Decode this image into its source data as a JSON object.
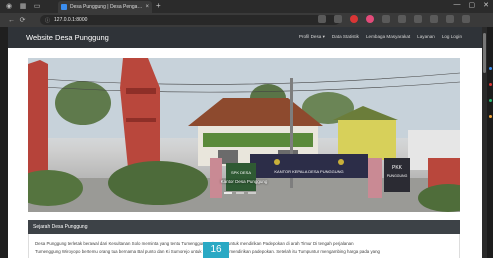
{
  "browser": {
    "tab_title": "Desa Punggung | Desa Pengadu...",
    "tab_close": "×",
    "new_tab": "+",
    "url": "127.0.0.1:8000",
    "window_controls": [
      "—",
      "▢",
      "✕"
    ],
    "nav_buttons": [
      "←",
      "⟳"
    ]
  },
  "site": {
    "brand": "Website Desa Punggung",
    "menu": [
      "Profil Desa ▾",
      "Data Statistik",
      "Lembaga Masyarakat",
      "Layanan",
      "Log Login"
    ]
  },
  "hero": {
    "caption": "Kantor Desa Punggung",
    "signs": {
      "left": "SPK DESA",
      "gate": "KANTOR KEPALA DESA PUNGGUNG",
      "right_top": "PKK",
      "right_bottom": "PUNGGUNG"
    }
  },
  "section": {
    "title": "Sejarah Desa Punggung",
    "paragraph_line1": "Desa Punggung terletak berawal dari Kesultanan Solo meminta yang tentu Tumenggung Wiroyopo untuk mendirikan Padepokan di arah Timur Di tengah perjalanan",
    "paragraph_line2": "Tumenggung Wiroyopo bertemu orang tua bernama Bal punto dan Ki Sumorejo untuk segera untuk mendirikan padepokan. Setelah itu Tumpuntur mengambing harga pada yang"
  },
  "overlay": {
    "page_number": "16"
  }
}
